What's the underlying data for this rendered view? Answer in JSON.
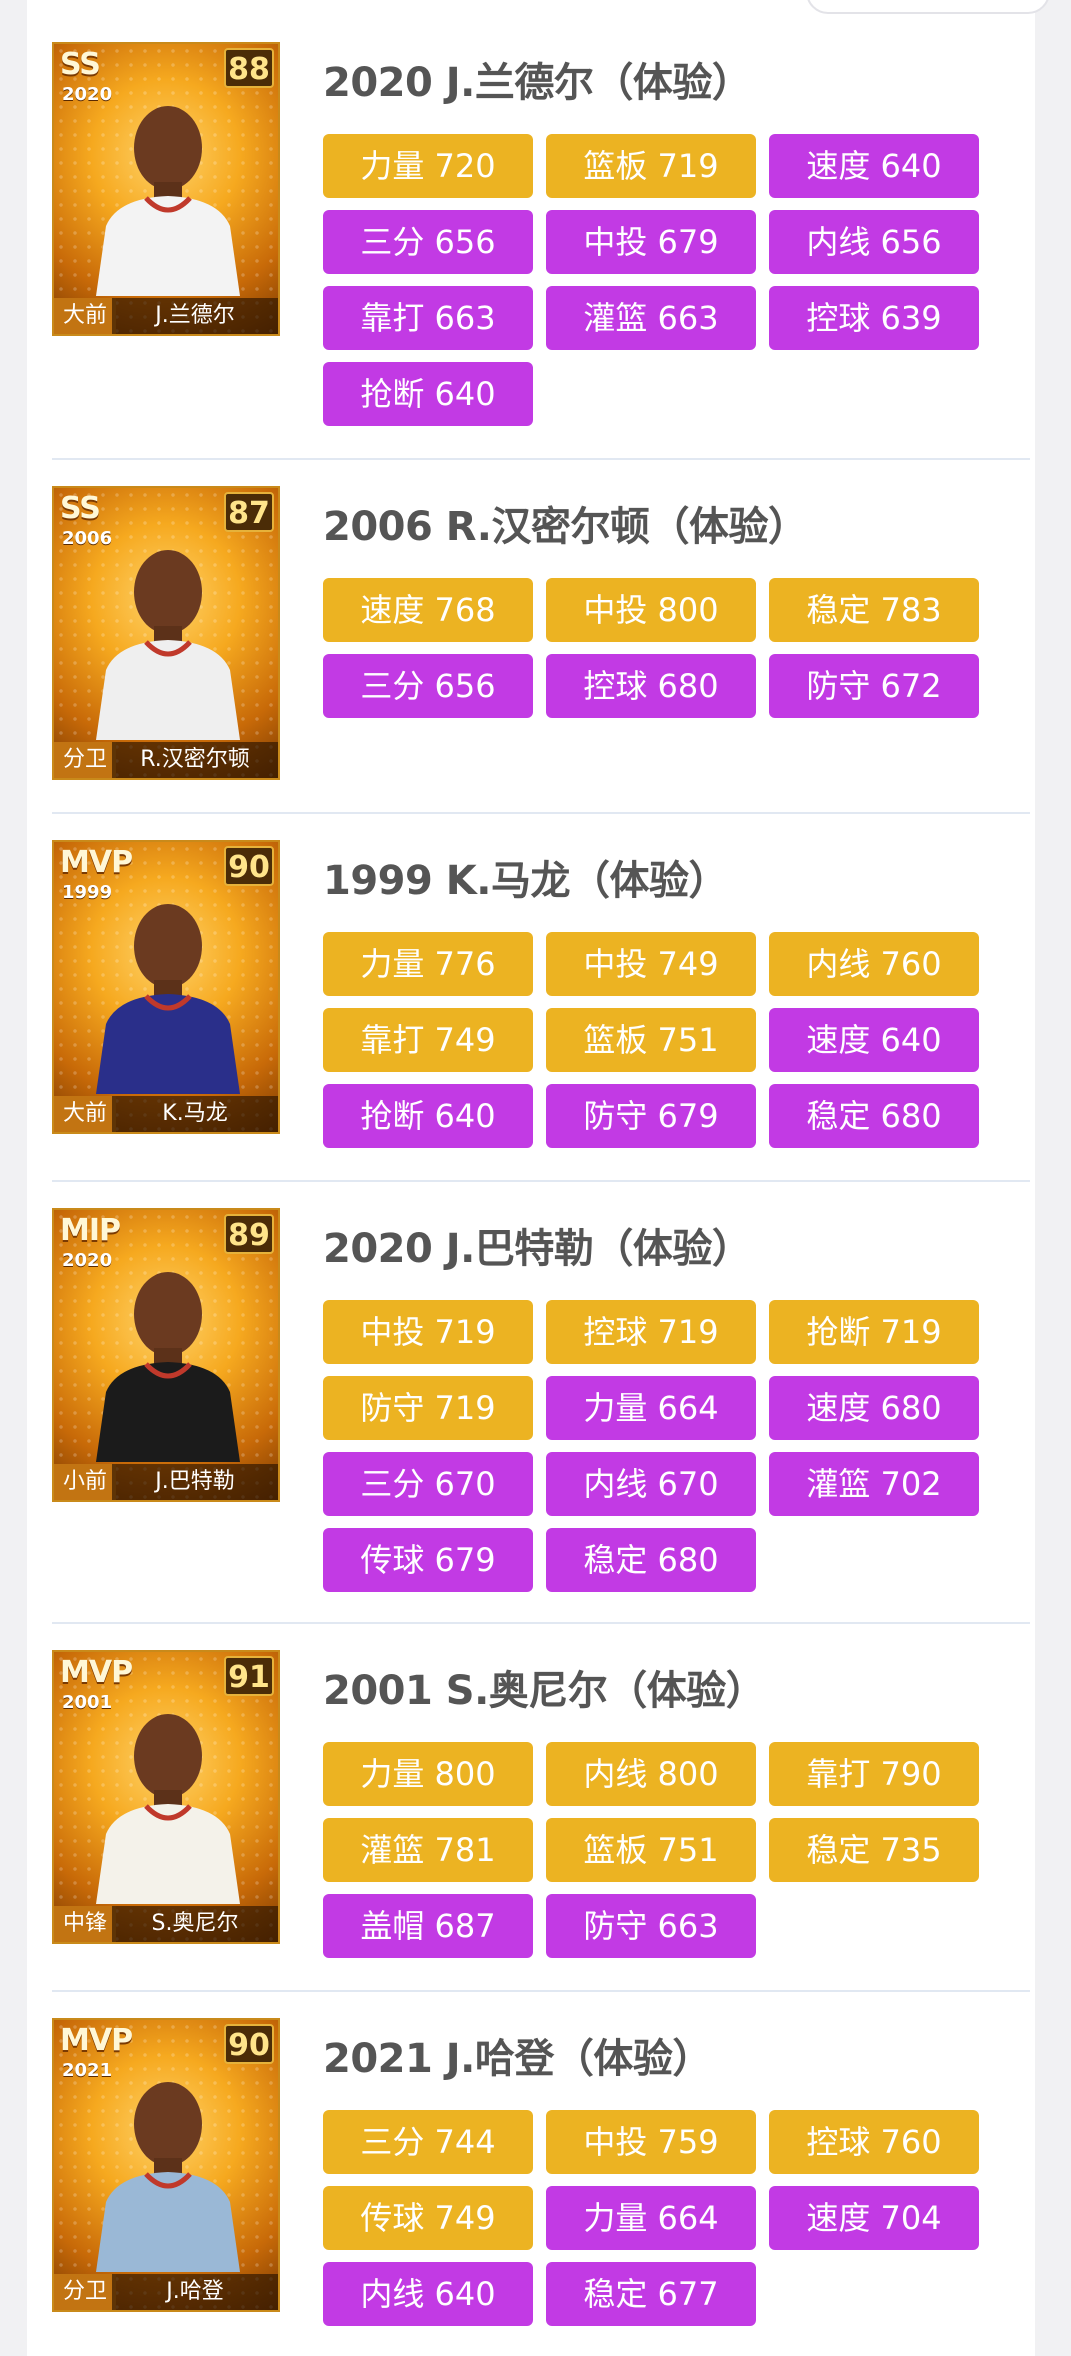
{
  "colors": {
    "gold": "#ecb322",
    "purple": "#c23ae4"
  },
  "players": [
    {
      "title": "2020 J.兰德尔（体验）",
      "card": {
        "rank": "SS",
        "year": "2020",
        "rating": "88",
        "position": "大前",
        "name": "J.兰德尔",
        "jersey": "#f3f3f3"
      },
      "stats": [
        {
          "label": "力量 720",
          "color": "gold"
        },
        {
          "label": "篮板 719",
          "color": "gold"
        },
        {
          "label": "速度 640",
          "color": "purple"
        },
        {
          "label": "三分 656",
          "color": "purple"
        },
        {
          "label": "中投 679",
          "color": "purple"
        },
        {
          "label": "内线 656",
          "color": "purple"
        },
        {
          "label": "靠打 663",
          "color": "purple"
        },
        {
          "label": "灌篮 663",
          "color": "purple"
        },
        {
          "label": "控球 639",
          "color": "purple"
        },
        {
          "label": "抢断 640",
          "color": "purple"
        }
      ]
    },
    {
      "title": "2006 R.汉密尔顿（体验）",
      "card": {
        "rank": "SS",
        "year": "2006",
        "rating": "87",
        "position": "分卫",
        "name": "R.汉密尔顿",
        "jersey": "#efefef"
      },
      "stats": [
        {
          "label": "速度 768",
          "color": "gold"
        },
        {
          "label": "中投 800",
          "color": "gold"
        },
        {
          "label": "稳定 783",
          "color": "gold"
        },
        {
          "label": "三分 656",
          "color": "purple"
        },
        {
          "label": "控球 680",
          "color": "purple"
        },
        {
          "label": "防守 672",
          "color": "purple"
        }
      ]
    },
    {
      "title": "1999 K.马龙（体验）",
      "card": {
        "rank": "MVP",
        "year": "1999",
        "rating": "90",
        "position": "大前",
        "name": "K.马龙",
        "jersey": "#2a2f8a"
      },
      "stats": [
        {
          "label": "力量 776",
          "color": "gold"
        },
        {
          "label": "中投 749",
          "color": "gold"
        },
        {
          "label": "内线 760",
          "color": "gold"
        },
        {
          "label": "靠打 749",
          "color": "gold"
        },
        {
          "label": "篮板 751",
          "color": "gold"
        },
        {
          "label": "速度 640",
          "color": "purple"
        },
        {
          "label": "抢断 640",
          "color": "purple"
        },
        {
          "label": "防守 679",
          "color": "purple"
        },
        {
          "label": "稳定 680",
          "color": "purple"
        }
      ]
    },
    {
      "title": "2020 J.巴特勒（体验）",
      "card": {
        "rank": "MIP",
        "year": "2020",
        "rating": "89",
        "position": "小前",
        "name": "J.巴特勒",
        "jersey": "#1b1b1b"
      },
      "stats": [
        {
          "label": "中投 719",
          "color": "gold"
        },
        {
          "label": "控球 719",
          "color": "gold"
        },
        {
          "label": "抢断 719",
          "color": "gold"
        },
        {
          "label": "防守 719",
          "color": "gold"
        },
        {
          "label": "力量 664",
          "color": "purple"
        },
        {
          "label": "速度 680",
          "color": "purple"
        },
        {
          "label": "三分 670",
          "color": "purple"
        },
        {
          "label": "内线 670",
          "color": "purple"
        },
        {
          "label": "灌篮 702",
          "color": "purple"
        },
        {
          "label": "传球 679",
          "color": "purple"
        },
        {
          "label": "稳定 680",
          "color": "purple"
        }
      ]
    },
    {
      "title": "2001 S.奥尼尔（体验）",
      "card": {
        "rank": "MVP",
        "year": "2001",
        "rating": "91",
        "position": "中锋",
        "name": "S.奥尼尔",
        "jersey": "#f4f2ea"
      },
      "stats": [
        {
          "label": "力量 800",
          "color": "gold"
        },
        {
          "label": "内线 800",
          "color": "gold"
        },
        {
          "label": "靠打 790",
          "color": "gold"
        },
        {
          "label": "灌篮 781",
          "color": "gold"
        },
        {
          "label": "篮板 751",
          "color": "gold"
        },
        {
          "label": "稳定 735",
          "color": "gold"
        },
        {
          "label": "盖帽 687",
          "color": "purple"
        },
        {
          "label": "防守 663",
          "color": "purple"
        }
      ]
    },
    {
      "title": "2021 J.哈登（体验）",
      "card": {
        "rank": "MVP",
        "year": "2021",
        "rating": "90",
        "position": "分卫",
        "name": "J.哈登",
        "jersey": "#9ab8d6"
      },
      "stats": [
        {
          "label": "三分 744",
          "color": "gold"
        },
        {
          "label": "中投 759",
          "color": "gold"
        },
        {
          "label": "控球 760",
          "color": "gold"
        },
        {
          "label": "传球 749",
          "color": "gold"
        },
        {
          "label": "力量 664",
          "color": "purple"
        },
        {
          "label": "速度 704",
          "color": "purple"
        },
        {
          "label": "内线 640",
          "color": "purple"
        },
        {
          "label": "稳定 677",
          "color": "purple"
        }
      ]
    }
  ]
}
